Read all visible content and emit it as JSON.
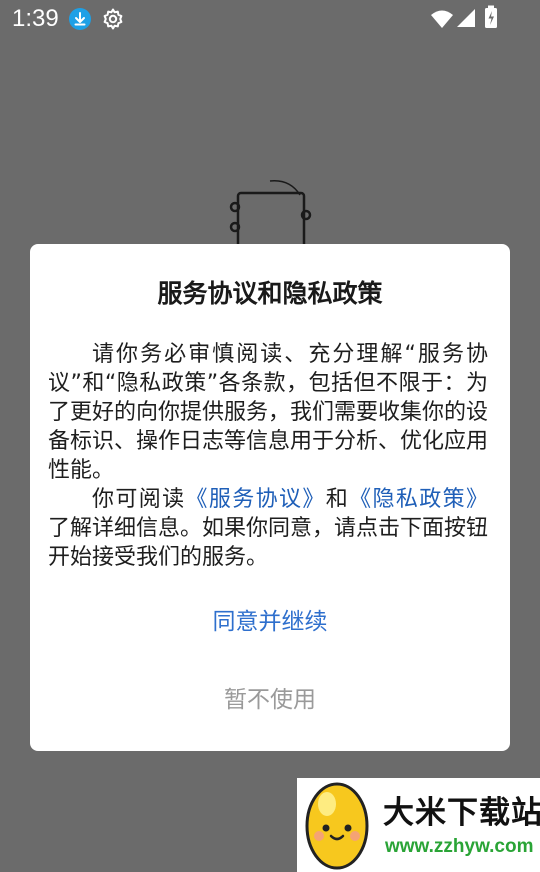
{
  "status_bar": {
    "time": "1:39",
    "icons": [
      "download-icon",
      "gear-icon",
      "wifi-icon",
      "signal-icon",
      "battery-icon"
    ]
  },
  "dialog": {
    "title": "服务协议和隐私政策",
    "paragraph1": "请你务必审慎阅读、充分理解“服务协议”和“隐私政策”各条款，包括但不限于：为了更好的向你提供服务，我们需要收集你的设备标识、操作日志等信息用于分析、优化应用性能。",
    "paragraph2_prefix": "你可阅读",
    "service_agreement_link": "《服务协议》",
    "paragraph2_and": "和",
    "privacy_policy_link": "《隐私政策》",
    "paragraph2_suffix": "了解详细信息。如果你同意，请点击下面按钮开始接受我们的服务。",
    "agree_label": "同意并继续",
    "decline_label": "暂不使用"
  },
  "watermark": {
    "name": "大米下载站",
    "url": "www.zzhyw.com"
  },
  "colors": {
    "link": "#1f5fb8",
    "agree_button": "#2e6fcd",
    "decline_button": "#9a9a9a",
    "overlay": "#6b6b6b",
    "download_badge": "#1ea0e6"
  }
}
